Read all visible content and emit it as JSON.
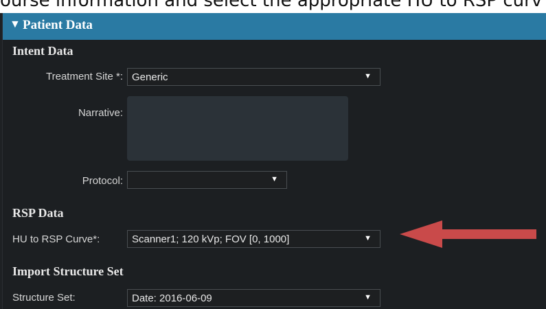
{
  "caption": "ourse information and select the appropriate HU to RSP curv",
  "panel": {
    "title": "Patient Data",
    "collapse_icon": "triangle-down-icon"
  },
  "intent": {
    "heading": "Intent Data",
    "treatment_site": {
      "label": "Treatment Site *:",
      "value": "Generic"
    },
    "narrative": {
      "label": "Narrative:",
      "value": ""
    },
    "protocol": {
      "label": "Protocol:",
      "value": ""
    }
  },
  "rsp": {
    "heading": "RSP Data",
    "curve": {
      "label": "HU to RSP Curve*:",
      "value": "Scanner1; 120 kVp; FOV [0, 1000]"
    }
  },
  "structure": {
    "heading": "Import Structure Set",
    "set": {
      "label": "Structure Set:",
      "value": "Date: 2016-06-09"
    }
  },
  "annotation": {
    "color": "#c94a4a",
    "icon": "arrow-left-icon"
  }
}
